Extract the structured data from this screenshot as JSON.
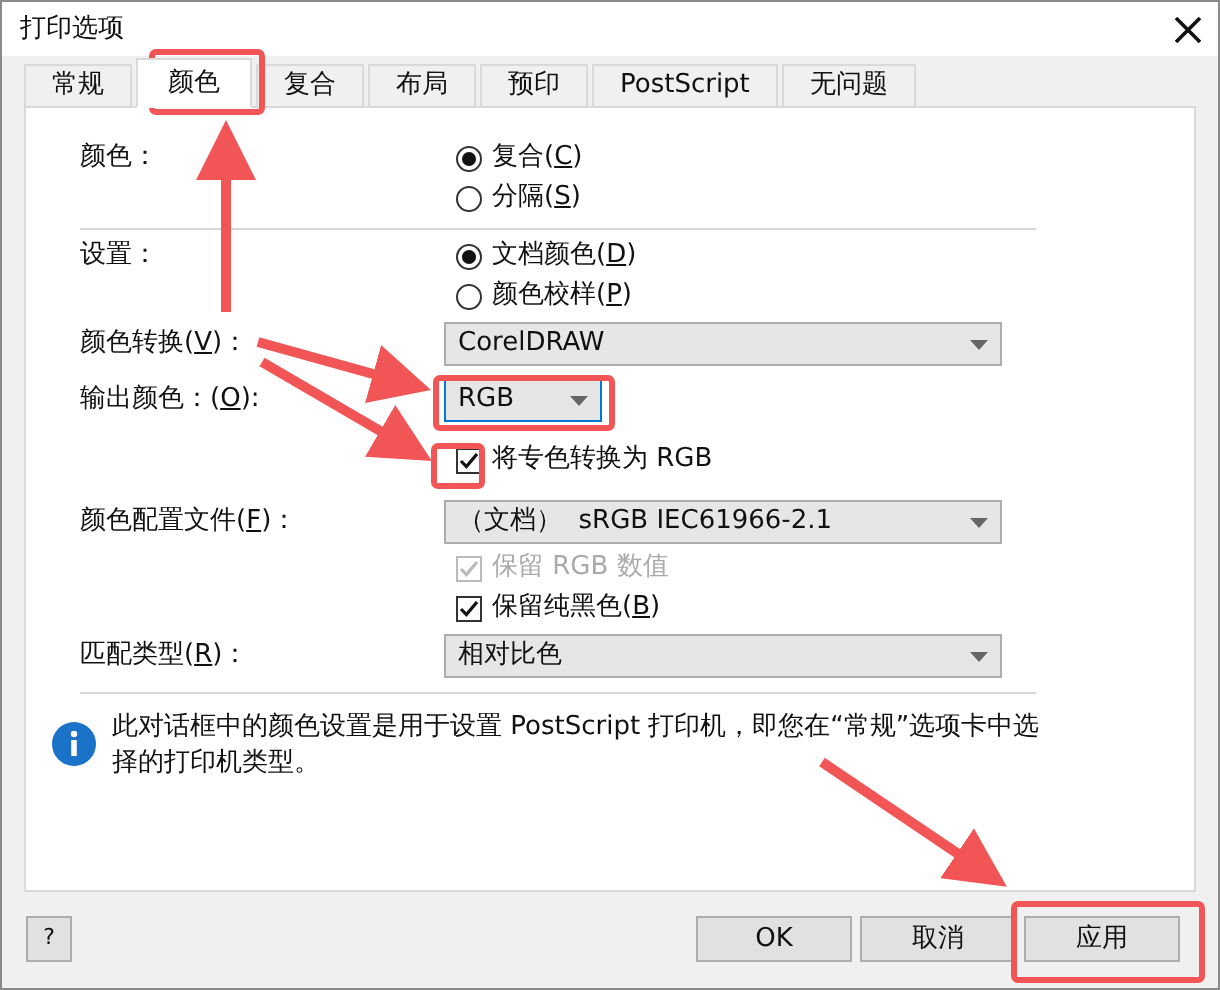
{
  "window": {
    "title": "打印选项"
  },
  "tabs": [
    {
      "label": "常规",
      "selected": false
    },
    {
      "label": "颜色",
      "selected": true
    },
    {
      "label": "复合",
      "selected": false
    },
    {
      "label": "布局",
      "selected": false
    },
    {
      "label": "预印",
      "selected": false
    },
    {
      "label": "PostScript",
      "selected": false
    },
    {
      "label": "无问题",
      "selected": false
    }
  ],
  "color_mode": {
    "label": "颜色：",
    "options": [
      {
        "label": [
          "复合(",
          "C",
          ")"
        ],
        "selected": true
      },
      {
        "label": [
          "分隔(",
          "S",
          ")"
        ],
        "selected": false
      }
    ]
  },
  "settings": {
    "label": "设置：",
    "options": [
      {
        "label": [
          "文档颜色(",
          "D",
          ")"
        ],
        "selected": true
      },
      {
        "label": [
          "颜色校样(",
          "P",
          ")"
        ],
        "selected": false
      }
    ]
  },
  "color_conversion": {
    "label": [
      "颜色转换(",
      "V",
      ")："
    ],
    "value": "CorelDRAW"
  },
  "output_color": {
    "label": [
      "输出颜色：(",
      "O",
      "):"
    ],
    "value": "RGB",
    "focused": true
  },
  "convert_spot": {
    "label": "将专色转换为 RGB",
    "checked": true,
    "disabled": false
  },
  "color_profile": {
    "label": [
      "颜色配置文件(",
      "F",
      ")："
    ],
    "value": "（文档）  sRGB IEC61966-2.1"
  },
  "profile_options": [
    {
      "label": "保留 RGB 数值",
      "checked": true,
      "disabled": true
    },
    {
      "label": [
        "保留纯黑色(",
        "B",
        ")"
      ],
      "checked": true,
      "disabled": false
    }
  ],
  "matching_type": {
    "label": [
      "匹配类型(",
      "R",
      ")："
    ],
    "value": "相对比色"
  },
  "info": "此对话框中的颜色设置是用于设置 PostScript 打印机，即您在“常规”选项卡中选择的打印机类型。",
  "buttons": {
    "help": "?",
    "actions": [
      "OK",
      "取消",
      "应用"
    ]
  }
}
